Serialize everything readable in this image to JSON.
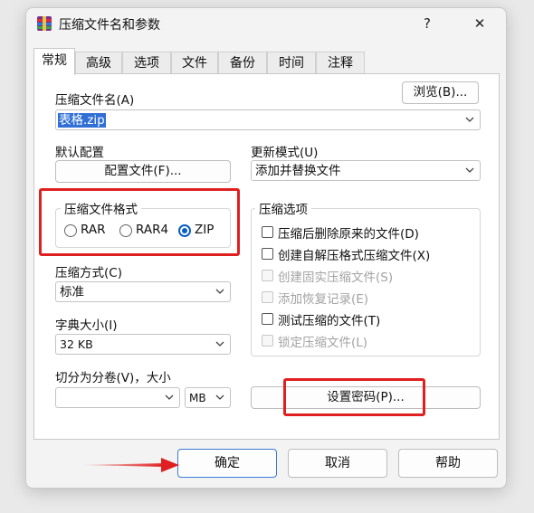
{
  "window": {
    "title": "压缩文件名和参数",
    "help_glyph": "?",
    "close_glyph": "✕"
  },
  "tabs": [
    "常规",
    "高级",
    "选项",
    "文件",
    "备份",
    "时间",
    "注释"
  ],
  "general": {
    "archive_name_label": "压缩文件名(A)",
    "archive_name_value": "表格.zip",
    "browse_button": "浏览(B)...",
    "default_profile_label": "默认配置",
    "profile_button": "配置文件(F)...",
    "update_mode_label": "更新模式(U)",
    "update_mode_value": "添加并替换文件",
    "format_group_title": "压缩文件格式",
    "formats": [
      {
        "label": "RAR",
        "selected": false
      },
      {
        "label": "RAR4",
        "selected": false
      },
      {
        "label": "ZIP",
        "selected": true
      }
    ],
    "compression_method_label": "压缩方式(C)",
    "compression_method_value": "标准",
    "dict_size_label": "字典大小(I)",
    "dict_size_value": "32 KB",
    "split_label": "切分为分卷(V)，大小",
    "split_value": "",
    "split_unit": "MB",
    "options_group_title": "压缩选项",
    "options": [
      {
        "label": "压缩后删除原来的文件(D)",
        "enabled": true,
        "checked": false
      },
      {
        "label": "创建自解压格式压缩文件(X)",
        "enabled": true,
        "checked": false
      },
      {
        "label": "创建固实压缩文件(S)",
        "enabled": false,
        "checked": false
      },
      {
        "label": "添加恢复记录(E)",
        "enabled": false,
        "checked": false
      },
      {
        "label": "测试压缩的文件(T)",
        "enabled": true,
        "checked": false
      },
      {
        "label": "锁定压缩文件(L)",
        "enabled": false,
        "checked": false
      }
    ],
    "set_password_button": "设置密码(P)..."
  },
  "footer": {
    "ok": "确定",
    "cancel": "取消",
    "help": "帮助"
  },
  "colors": {
    "annotation_red": "#e02020",
    "selection_blue": "#2f6fd6",
    "accent_blue": "#0a5fc4"
  }
}
